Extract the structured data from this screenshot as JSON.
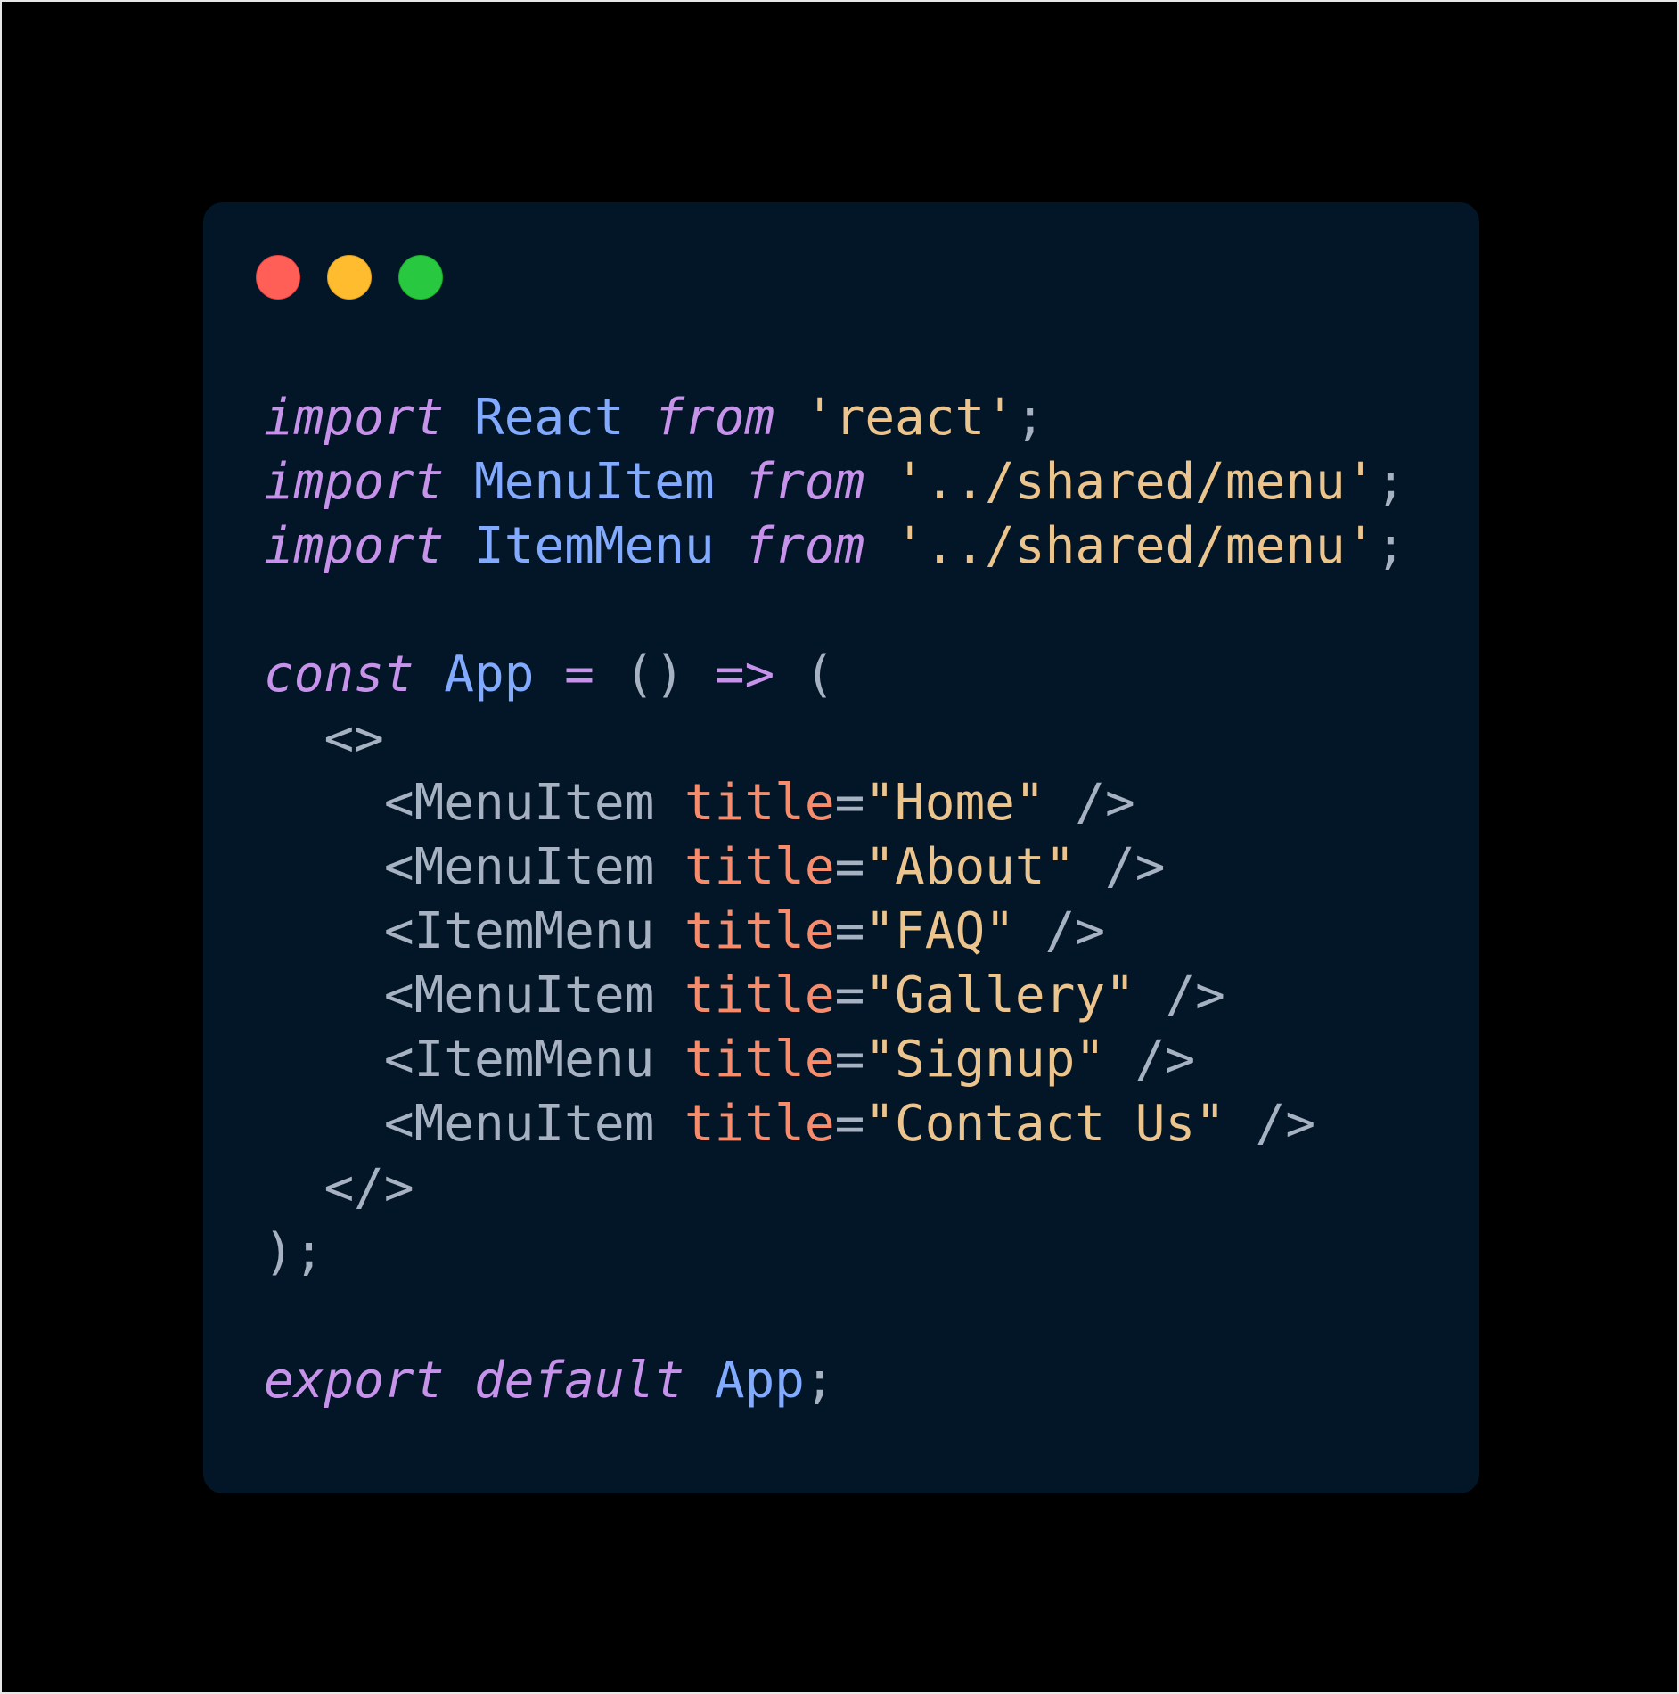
{
  "window_controls": {
    "close_color": "#ff5f57",
    "minimize_color": "#febc2e",
    "maximize_color": "#28c840",
    "icons": [
      "close-icon",
      "minimize-icon",
      "maximize-icon"
    ]
  },
  "theme": {
    "background": "#021627",
    "keyword": "#c792ea",
    "identifier": "#82aaff",
    "string": "#ecc48d",
    "attribute": "#f78c6c",
    "punctuation": "#a6b1c2"
  },
  "code": {
    "l1": {
      "kw1": "import",
      "id": "React",
      "kw2": "from",
      "str": "'react'",
      "end": ";"
    },
    "l2": {
      "kw1": "import",
      "id": "MenuItem",
      "kw2": "from",
      "str": "'../shared/menu'",
      "end": ";"
    },
    "l3": {
      "kw1": "import",
      "id": "ItemMenu",
      "kw2": "from",
      "str": "'../shared/menu'",
      "end": ";"
    },
    "l5": {
      "kw": "const",
      "id": "App",
      "eq": "=",
      "parens": "()",
      "arrow": "=>",
      "open": "("
    },
    "l6": {
      "frag_open": "<>"
    },
    "items": [
      {
        "tag": "<MenuItem",
        "attr": "title",
        "eq": "=",
        "val": "\"Home\"",
        "close": "/>"
      },
      {
        "tag": "<MenuItem",
        "attr": "title",
        "eq": "=",
        "val": "\"About\"",
        "close": "/>"
      },
      {
        "tag": "<ItemMenu",
        "attr": "title",
        "eq": "=",
        "val": "\"FAQ\"",
        "close": "/>"
      },
      {
        "tag": "<MenuItem",
        "attr": "title",
        "eq": "=",
        "val": "\"Gallery\"",
        "close": "/>"
      },
      {
        "tag": "<ItemMenu",
        "attr": "title",
        "eq": "=",
        "val": "\"Signup\"",
        "close": "/>"
      },
      {
        "tag": "<MenuItem",
        "attr": "title",
        "eq": "=",
        "val": "\"Contact Us\"",
        "close": "/>"
      }
    ],
    "l13": {
      "frag_close": "</>"
    },
    "l14": {
      "end": ");"
    },
    "l16": {
      "kw1": "export",
      "kw2": "default",
      "id": "App",
      "end": ";"
    }
  }
}
